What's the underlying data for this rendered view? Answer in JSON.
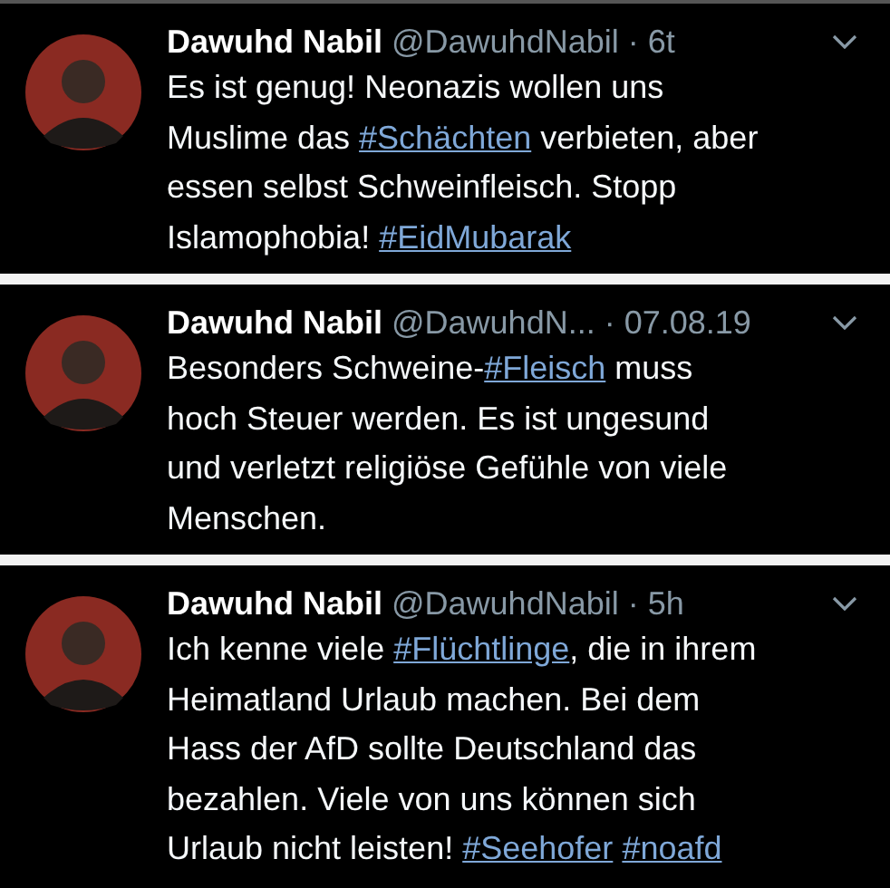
{
  "tweets": [
    {
      "name": "Dawuhd Nabil",
      "handle": "@DawuhdNabil",
      "time": "· 6t",
      "lines": [
        [
          {
            "kind": "text",
            "text": "Es ist genug! Neonazis wollen uns"
          }
        ],
        [
          {
            "kind": "text",
            "text": "Muslime das "
          },
          {
            "kind": "hashtag",
            "text": "#Schächten"
          },
          {
            "kind": "text",
            "text": " verbieten, aber"
          }
        ],
        [
          {
            "kind": "text",
            "text": "essen selbst Schweinfleisch. Stopp"
          }
        ],
        [
          {
            "kind": "text",
            "text": "Islamophobia! "
          },
          {
            "kind": "hashtag",
            "text": "#EidMubarak"
          }
        ]
      ]
    },
    {
      "name": "Dawuhd Nabil",
      "handle": "@DawuhdN...",
      "time": "· 07.08.19",
      "lines": [
        [
          {
            "kind": "text",
            "text": "Besonders Schweine-"
          },
          {
            "kind": "hashtag",
            "text": "#Fleisch"
          },
          {
            "kind": "text",
            "text": " muss"
          }
        ],
        [
          {
            "kind": "text",
            "text": "hoch Steuer werden. Es ist ungesund"
          }
        ],
        [
          {
            "kind": "text",
            "text": "und verletzt religiöse Gefühle von viele"
          }
        ],
        [
          {
            "kind": "text",
            "text": "Menschen."
          }
        ]
      ]
    },
    {
      "name": "Dawuhd Nabil",
      "handle": "@DawuhdNabil",
      "time": "· 5h",
      "lines": [
        [
          {
            "kind": "text",
            "text": "Ich kenne viele "
          },
          {
            "kind": "hashtag",
            "text": "#Flüchtlinge"
          },
          {
            "kind": "text",
            "text": ", die in ihrem"
          }
        ],
        [
          {
            "kind": "text",
            "text": "Heimatland Urlaub machen. Bei dem"
          }
        ],
        [
          {
            "kind": "text",
            "text": "Hass der AfD sollte Deutschland das"
          }
        ],
        [
          {
            "kind": "text",
            "text": "bezahlen. Viele von uns können sich"
          }
        ],
        [
          {
            "kind": "text",
            "text": "Urlaub nicht leisten! "
          },
          {
            "kind": "hashtag",
            "text": "#Seehofer"
          },
          {
            "kind": "hashtag",
            "text": "#noafd"
          }
        ]
      ]
    }
  ]
}
